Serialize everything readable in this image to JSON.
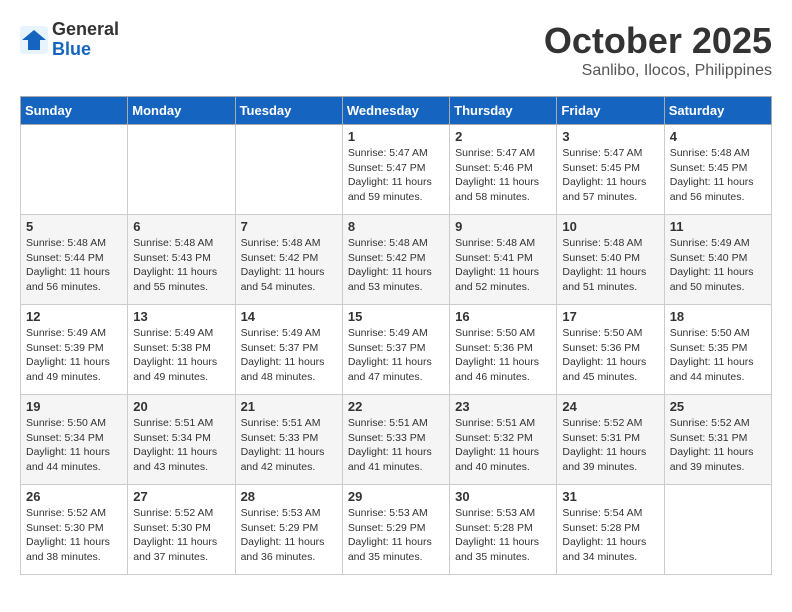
{
  "logo": {
    "general": "General",
    "blue": "Blue"
  },
  "header": {
    "month": "October 2025",
    "location": "Sanlibo, Ilocos, Philippines"
  },
  "weekdays": [
    "Sunday",
    "Monday",
    "Tuesday",
    "Wednesday",
    "Thursday",
    "Friday",
    "Saturday"
  ],
  "weeks": [
    [
      {
        "day": "",
        "info": ""
      },
      {
        "day": "",
        "info": ""
      },
      {
        "day": "",
        "info": ""
      },
      {
        "day": "1",
        "info": "Sunrise: 5:47 AM\nSunset: 5:47 PM\nDaylight: 11 hours\nand 59 minutes."
      },
      {
        "day": "2",
        "info": "Sunrise: 5:47 AM\nSunset: 5:46 PM\nDaylight: 11 hours\nand 58 minutes."
      },
      {
        "day": "3",
        "info": "Sunrise: 5:47 AM\nSunset: 5:45 PM\nDaylight: 11 hours\nand 57 minutes."
      },
      {
        "day": "4",
        "info": "Sunrise: 5:48 AM\nSunset: 5:45 PM\nDaylight: 11 hours\nand 56 minutes."
      }
    ],
    [
      {
        "day": "5",
        "info": "Sunrise: 5:48 AM\nSunset: 5:44 PM\nDaylight: 11 hours\nand 56 minutes."
      },
      {
        "day": "6",
        "info": "Sunrise: 5:48 AM\nSunset: 5:43 PM\nDaylight: 11 hours\nand 55 minutes."
      },
      {
        "day": "7",
        "info": "Sunrise: 5:48 AM\nSunset: 5:42 PM\nDaylight: 11 hours\nand 54 minutes."
      },
      {
        "day": "8",
        "info": "Sunrise: 5:48 AM\nSunset: 5:42 PM\nDaylight: 11 hours\nand 53 minutes."
      },
      {
        "day": "9",
        "info": "Sunrise: 5:48 AM\nSunset: 5:41 PM\nDaylight: 11 hours\nand 52 minutes."
      },
      {
        "day": "10",
        "info": "Sunrise: 5:48 AM\nSunset: 5:40 PM\nDaylight: 11 hours\nand 51 minutes."
      },
      {
        "day": "11",
        "info": "Sunrise: 5:49 AM\nSunset: 5:40 PM\nDaylight: 11 hours\nand 50 minutes."
      }
    ],
    [
      {
        "day": "12",
        "info": "Sunrise: 5:49 AM\nSunset: 5:39 PM\nDaylight: 11 hours\nand 49 minutes."
      },
      {
        "day": "13",
        "info": "Sunrise: 5:49 AM\nSunset: 5:38 PM\nDaylight: 11 hours\nand 49 minutes."
      },
      {
        "day": "14",
        "info": "Sunrise: 5:49 AM\nSunset: 5:37 PM\nDaylight: 11 hours\nand 48 minutes."
      },
      {
        "day": "15",
        "info": "Sunrise: 5:49 AM\nSunset: 5:37 PM\nDaylight: 11 hours\nand 47 minutes."
      },
      {
        "day": "16",
        "info": "Sunrise: 5:50 AM\nSunset: 5:36 PM\nDaylight: 11 hours\nand 46 minutes."
      },
      {
        "day": "17",
        "info": "Sunrise: 5:50 AM\nSunset: 5:36 PM\nDaylight: 11 hours\nand 45 minutes."
      },
      {
        "day": "18",
        "info": "Sunrise: 5:50 AM\nSunset: 5:35 PM\nDaylight: 11 hours\nand 44 minutes."
      }
    ],
    [
      {
        "day": "19",
        "info": "Sunrise: 5:50 AM\nSunset: 5:34 PM\nDaylight: 11 hours\nand 44 minutes."
      },
      {
        "day": "20",
        "info": "Sunrise: 5:51 AM\nSunset: 5:34 PM\nDaylight: 11 hours\nand 43 minutes."
      },
      {
        "day": "21",
        "info": "Sunrise: 5:51 AM\nSunset: 5:33 PM\nDaylight: 11 hours\nand 42 minutes."
      },
      {
        "day": "22",
        "info": "Sunrise: 5:51 AM\nSunset: 5:33 PM\nDaylight: 11 hours\nand 41 minutes."
      },
      {
        "day": "23",
        "info": "Sunrise: 5:51 AM\nSunset: 5:32 PM\nDaylight: 11 hours\nand 40 minutes."
      },
      {
        "day": "24",
        "info": "Sunrise: 5:52 AM\nSunset: 5:31 PM\nDaylight: 11 hours\nand 39 minutes."
      },
      {
        "day": "25",
        "info": "Sunrise: 5:52 AM\nSunset: 5:31 PM\nDaylight: 11 hours\nand 39 minutes."
      }
    ],
    [
      {
        "day": "26",
        "info": "Sunrise: 5:52 AM\nSunset: 5:30 PM\nDaylight: 11 hours\nand 38 minutes."
      },
      {
        "day": "27",
        "info": "Sunrise: 5:52 AM\nSunset: 5:30 PM\nDaylight: 11 hours\nand 37 minutes."
      },
      {
        "day": "28",
        "info": "Sunrise: 5:53 AM\nSunset: 5:29 PM\nDaylight: 11 hours\nand 36 minutes."
      },
      {
        "day": "29",
        "info": "Sunrise: 5:53 AM\nSunset: 5:29 PM\nDaylight: 11 hours\nand 35 minutes."
      },
      {
        "day": "30",
        "info": "Sunrise: 5:53 AM\nSunset: 5:28 PM\nDaylight: 11 hours\nand 35 minutes."
      },
      {
        "day": "31",
        "info": "Sunrise: 5:54 AM\nSunset: 5:28 PM\nDaylight: 11 hours\nand 34 minutes."
      },
      {
        "day": "",
        "info": ""
      }
    ]
  ]
}
